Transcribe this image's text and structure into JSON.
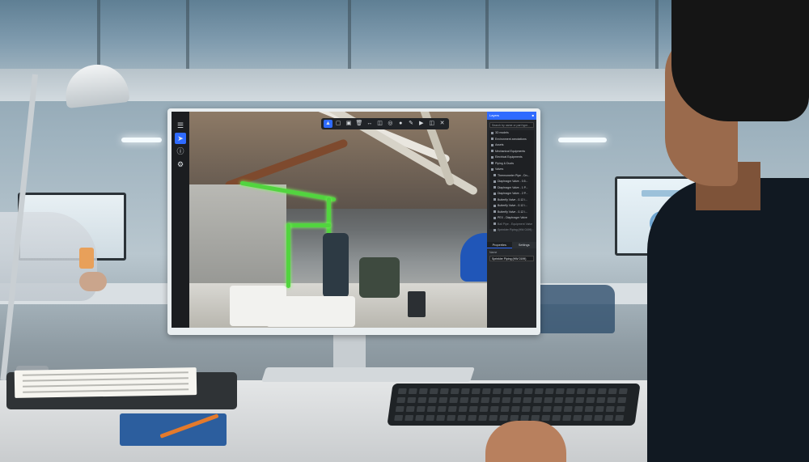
{
  "colors": {
    "accent": "#2f6bff",
    "panel_bg": "#26292d",
    "highlight_green": "#52d43f"
  },
  "left_rail": {
    "buttons": [
      {
        "icon": "layers-icon"
      },
      {
        "icon": "cursor-icon",
        "active": true
      },
      {
        "icon": "info-icon"
      },
      {
        "icon": "settings-icon"
      }
    ]
  },
  "toolbar": {
    "tools": [
      {
        "icon": "select-icon",
        "active": true
      },
      {
        "icon": "window-icon"
      },
      {
        "icon": "box-icon"
      },
      {
        "icon": "trash-icon"
      },
      {
        "icon": "measure-icon"
      },
      {
        "icon": "cube-icon"
      },
      {
        "icon": "target-icon"
      },
      {
        "icon": "pin-icon"
      },
      {
        "icon": "pencil-icon"
      },
      {
        "icon": "play-icon"
      },
      {
        "icon": "split-icon"
      },
      {
        "icon": "close-icon"
      }
    ]
  },
  "panel": {
    "title": "Layers",
    "search_placeholder": "Search by name or part type...",
    "tree": [
      {
        "label": "3D models",
        "icon": "folder-icon"
      },
      {
        "label": "Environment annotations",
        "icon": "folder-icon"
      },
      {
        "label": "Assets",
        "icon": "folder-icon"
      },
      {
        "label": "Mechanical Equipments",
        "icon": "folder-icon"
      },
      {
        "label": "Electrical Equipments",
        "icon": "folder-icon"
      },
      {
        "label": "Piping & Ducts",
        "icon": "folder-icon"
      },
      {
        "label": "Valves",
        "icon": "folder-icon"
      },
      {
        "label": "Thermometer Pipe - Dn...",
        "icon": "pipe-icon",
        "child": true
      },
      {
        "label": "Diaphragm Valve - 0.5...",
        "icon": "pipe-icon",
        "child": true
      },
      {
        "label": "Diaphragm Valve - 1 P...",
        "icon": "pipe-icon",
        "child": true
      },
      {
        "label": "Diaphragm Valve - 2 P...",
        "icon": "pipe-icon",
        "child": true
      },
      {
        "label": "Butterfly Valve - 0.12 l...",
        "icon": "pipe-icon",
        "child": true
      },
      {
        "label": "Butterfly Valve - 0.12 l...",
        "icon": "pipe-icon",
        "child": true
      },
      {
        "label": "Butterfly Valve - 0.12 l...",
        "icon": "pipe-icon",
        "child": true
      },
      {
        "label": "PEX - Diaphragm Valve",
        "icon": "pipe-icon",
        "child": true
      },
      {
        "label": "Ball Pipe - Equipment Valve",
        "icon": "pipe-icon",
        "child": true,
        "dim": true
      },
      {
        "label": "Sprinkler Piping (HW 0199)",
        "icon": "pipe-icon",
        "child": true,
        "dim": true
      }
    ],
    "tabs": [
      "Properties",
      "Settings"
    ],
    "property_label": "Name",
    "property_value": "Sprinkler Piping (HW 0199)"
  }
}
